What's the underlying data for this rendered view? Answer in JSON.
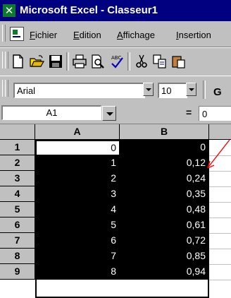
{
  "window": {
    "title": "Microsoft Excel - Classeur1"
  },
  "menu": {
    "items": [
      {
        "accel": "F",
        "rest": "ichier"
      },
      {
        "accel": "E",
        "rest": "dition"
      },
      {
        "accel": "A",
        "rest": "ffichage"
      },
      {
        "accel": "I",
        "rest": "nsertion"
      }
    ]
  },
  "toolbar": {
    "buttons": [
      "new-file-icon",
      "open-folder-icon",
      "save-disk-icon",
      "print-icon",
      "print-preview-icon",
      "spelling-icon",
      "cut-icon",
      "copy-icon"
    ],
    "font_name": "Arial",
    "font_size": "10",
    "bold_label": "G"
  },
  "formula_bar": {
    "name_box": "A1",
    "equals": "=",
    "value": "0"
  },
  "sheet": {
    "columns": [
      "A",
      "B"
    ],
    "rows": [
      {
        "num": "1",
        "a": "0",
        "b": "0"
      },
      {
        "num": "2",
        "a": "1",
        "b": "0,12"
      },
      {
        "num": "3",
        "a": "2",
        "b": "0,24"
      },
      {
        "num": "4",
        "a": "3",
        "b": "0,35"
      },
      {
        "num": "5",
        "a": "4",
        "b": "0,48"
      },
      {
        "num": "6",
        "a": "5",
        "b": "0,61"
      },
      {
        "num": "7",
        "a": "6",
        "b": "0,72"
      },
      {
        "num": "8",
        "a": "7",
        "b": "0,85"
      },
      {
        "num": "9",
        "a": "8",
        "b": "0,94"
      }
    ]
  },
  "colors": {
    "title_bar": "#000080",
    "selection": "#000000",
    "annotation_arrow": "#ff0000",
    "chrome": "#c0c0c0"
  }
}
